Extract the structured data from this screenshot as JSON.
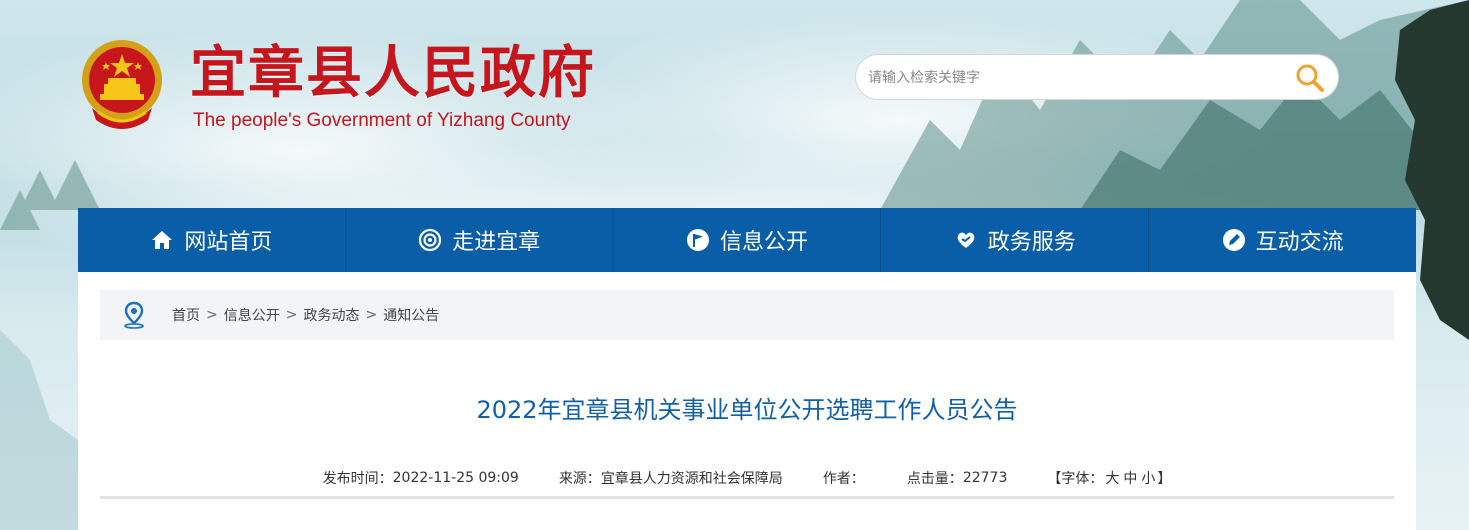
{
  "header": {
    "title": "宜章县人民政府",
    "subtitle": "The people's Government of Yizhang County",
    "search_placeholder": "请输入检索关键字"
  },
  "nav": [
    {
      "label": "网站首页",
      "icon": "home-icon"
    },
    {
      "label": "走进宜章",
      "icon": "target-icon"
    },
    {
      "label": "信息公开",
      "icon": "flag-icon"
    },
    {
      "label": "政务服务",
      "icon": "heart-hands-icon"
    },
    {
      "label": "互动交流",
      "icon": "pencil-icon"
    }
  ],
  "breadcrumb": {
    "icon": "location-pin-icon",
    "items": [
      "首页",
      "信息公开",
      "政务动态",
      "通知公告"
    ],
    "separator": ">"
  },
  "article": {
    "title": "2022年宜章县机关事业单位公开选聘工作人员公告",
    "publish_label": "发布时间：",
    "publish_time": "2022-11-25 09:09",
    "source_label": "来源：",
    "source": "宜章县人力资源和社会保障局",
    "author_label": "作者：",
    "author": "",
    "clicks_label": "点击量：",
    "clicks": "22773",
    "font_label_open": "【字体：",
    "font_large": "大",
    "font_medium": "中",
    "font_small": "小",
    "font_label_close": "】"
  },
  "colors": {
    "brand_red": "#c4161c",
    "nav_blue": "#0a5ea8",
    "title_blue": "#1260a8",
    "search_icon": "#f0a22e"
  }
}
